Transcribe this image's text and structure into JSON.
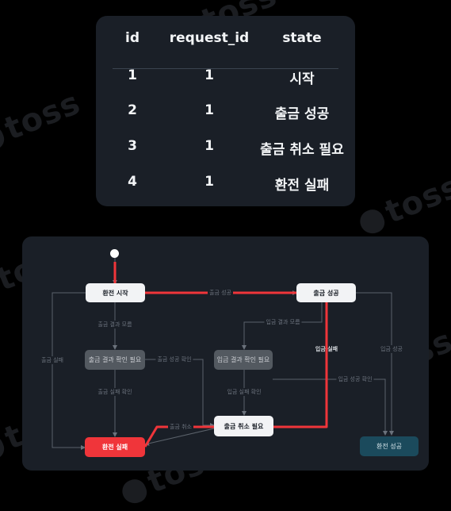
{
  "table": {
    "headers": [
      "id",
      "request_id",
      "state"
    ],
    "rows": [
      [
        "1",
        "1",
        "시작"
      ],
      [
        "2",
        "1",
        "출금 성공"
      ],
      [
        "3",
        "1",
        "출금 취소 필요"
      ],
      [
        "4",
        "1",
        "환전 실패"
      ]
    ]
  },
  "diagram": {
    "nodes": {
      "start_exchange": "환전 시작",
      "withdraw_success": "출금 성공",
      "withdraw_check": "출금 결과 확인 필요",
      "deposit_check": "입금 결과 확인 필요",
      "withdraw_cancel_needed": "출금 취소 필요",
      "exchange_fail": "환전 실패",
      "exchange_success": "환전 성공"
    },
    "edges": {
      "withdraw_success": "출금 성공",
      "withdraw_unknown": "출금 결과 모름",
      "withdraw_fail_left": "출금 실패",
      "withdraw_success_confirm": "출금 성공 확인",
      "withdraw_fail_confirm": "출금 실패 확인",
      "deposit_unknown": "입금 결과 모름",
      "deposit_fail": "입금 실패",
      "deposit_success": "입금 성공",
      "deposit_success_confirm": "입금 성공 확인",
      "deposit_fail_confirm": "입금 실패 확인",
      "withdraw_cancel": "출금 취소"
    }
  },
  "colors": {
    "background": "#000000",
    "card": "#1a1f27",
    "highlight_path": "#f0353a",
    "success_node": "#1b4a5c",
    "grey_node": "#535960"
  },
  "watermark": "toss"
}
